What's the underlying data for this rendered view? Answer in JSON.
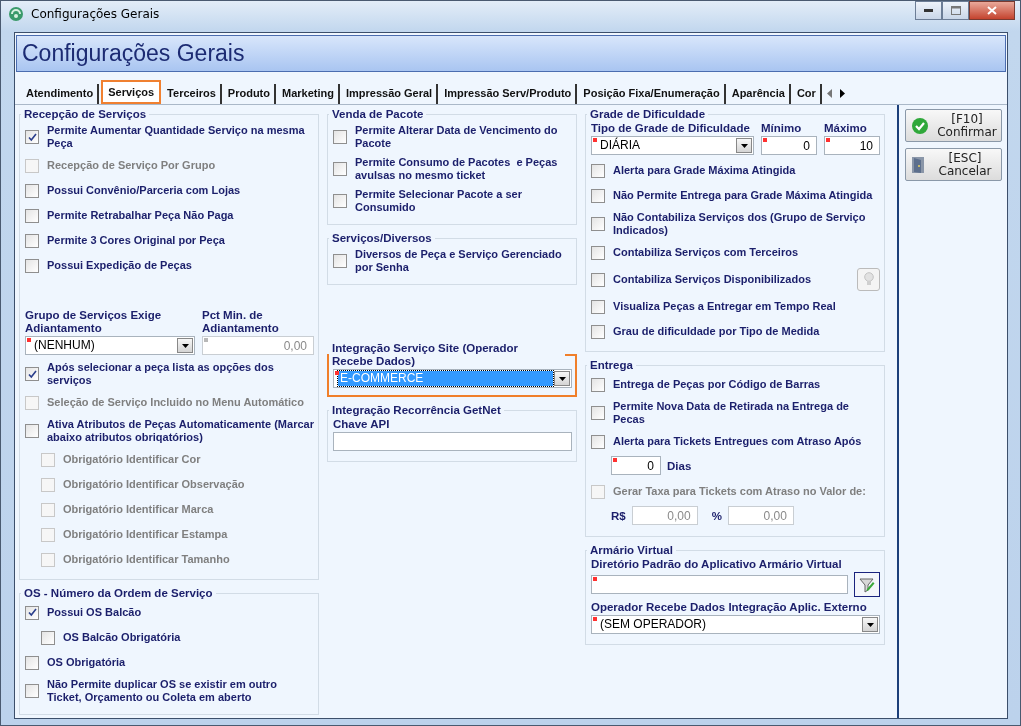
{
  "window": {
    "title": "Configurações Gerais"
  },
  "header": {
    "title": "Configurações Gerais"
  },
  "tabs": [
    {
      "label": "Atendimento",
      "selected": false
    },
    {
      "label": "Serviços",
      "selected": true
    },
    {
      "label": "Terceiros",
      "selected": false
    },
    {
      "label": "Produto",
      "selected": false
    },
    {
      "label": "Marketing",
      "selected": false
    },
    {
      "label": "Impressão Geral",
      "selected": false
    },
    {
      "label": "Impressão Serv/Produto",
      "selected": false
    },
    {
      "label": "Posição Fixa/Enumeração",
      "selected": false
    },
    {
      "label": "Aparência",
      "selected": false
    },
    {
      "label": "Cor",
      "selected": false
    }
  ],
  "columns": [
    {
      "sections": [
        {
          "title": "Recepção de Serviços",
          "highlighted": false,
          "items": [
            {
              "kind": "checkbox",
              "label": "Permite Aumentar Quantidade Serviço na mesma Peça",
              "checked": true,
              "disabled": false
            },
            {
              "kind": "checkbox",
              "label": "Recepção de Serviço Por Grupo",
              "checked": false,
              "disabled": true
            },
            {
              "kind": "checkbox",
              "label": "Possui Convênio/Parceria com Lojas",
              "checked": false,
              "disabled": false
            },
            {
              "kind": "checkbox",
              "label": "Permite Retrabalhar Peça Não Paga",
              "checked": false,
              "disabled": false
            },
            {
              "kind": "checkbox",
              "label": "Permite 3 Cores Original por Peça",
              "checked": false,
              "disabled": false
            },
            {
              "kind": "checkbox",
              "label": "Possui Expedição de Peças",
              "checked": false,
              "disabled": false
            },
            {
              "kind": "fields",
              "fields": [
                {
                  "kind": "combo",
                  "label": "Grupo de Serviços Exige Adiantamento",
                  "value": "(NENHUM)",
                  "required": true,
                  "disabled": false,
                  "focused": false
                },
                {
                  "kind": "number",
                  "label": "Pct Min. de Adiantamento",
                  "value": "0,00",
                  "required": true,
                  "disabled": true
                }
              ]
            },
            {
              "kind": "checkbox",
              "label": "Após selecionar a peça lista as opções dos serviços",
              "checked": true,
              "disabled": false
            },
            {
              "kind": "checkbox",
              "label": "Seleção de Serviço Incluido no Menu Automático",
              "checked": false,
              "disabled": true
            },
            {
              "kind": "checkbox",
              "label": "Ativa Atributos de Peças Automaticamente (Marcar abaixo atributos obriqatórios)",
              "checked": false,
              "disabled": false,
              "children": [
                {
                  "kind": "checkbox",
                  "label": "Obrigatório Identificar Cor",
                  "checked": false,
                  "disabled": true
                },
                {
                  "kind": "checkbox",
                  "label": "Obrigatório Identificar Observação",
                  "checked": false,
                  "disabled": true
                },
                {
                  "kind": "checkbox",
                  "label": "Obrigatório Identificar Marca",
                  "checked": false,
                  "disabled": true
                },
                {
                  "kind": "checkbox",
                  "label": "Obrigatório Identificar Estampa",
                  "checked": false,
                  "disabled": true
                },
                {
                  "kind": "checkbox",
                  "label": "Obrigatório Identificar Tamanho",
                  "checked": false,
                  "disabled": true
                }
              ]
            }
          ]
        },
        {
          "title": "OS - Número da Ordem de Serviço",
          "highlighted": false,
          "items": [
            {
              "kind": "checkbox",
              "label": "Possui OS Balcão",
              "checked": true,
              "disabled": false,
              "children": [
                {
                  "kind": "checkbox",
                  "label": "OS Balcão Obrigatória",
                  "checked": false,
                  "disabled": false
                }
              ]
            },
            {
              "kind": "checkbox",
              "label": "OS Obrigatória",
              "checked": false,
              "disabled": false
            },
            {
              "kind": "checkbox",
              "label": "Não Permite duplicar OS se existir em outro Ticket, Orçamento ou Coleta em aberto",
              "checked": false,
              "disabled": false
            }
          ]
        }
      ]
    },
    {
      "sections": [
        {
          "title": "Venda de Pacote",
          "highlighted": false,
          "items": [
            {
              "kind": "checkbox",
              "label": "Permite Alterar Data de Vencimento do Pacote",
              "checked": false,
              "disabled": false
            },
            {
              "kind": "checkbox",
              "label": "Permite Consumo de Pacotes  e Peças avulsas no mesmo ticket",
              "checked": false,
              "disabled": false
            },
            {
              "kind": "checkbox",
              "label": "Permite Selecionar Pacote a ser Consumido",
              "checked": false,
              "disabled": false
            }
          ]
        },
        {
          "title": "Serviços/Diversos",
          "highlighted": false,
          "items": [
            {
              "kind": "checkbox",
              "label": "Diversos de Peça e Serviço Gerenciado por Senha",
              "checked": false,
              "disabled": false
            }
          ]
        },
        {
          "title": "Integração Serviço Site (Operador Recebe Dados)",
          "highlighted": true,
          "items": [
            {
              "kind": "fields",
              "fields": [
                {
                  "kind": "combo",
                  "value": "E-COMMERCE",
                  "required": true,
                  "disabled": false,
                  "focused": true
                }
              ]
            }
          ]
        },
        {
          "title": "Integração Recorrência GetNet",
          "highlighted": false,
          "items": [
            {
              "kind": "fields",
              "fields": [
                {
                  "kind": "text",
                  "label": "Chave API",
                  "required": false,
                  "disabled": false
                }
              ]
            }
          ]
        }
      ]
    },
    {
      "sections": [
        {
          "title": "Grade de Dificuldade",
          "highlighted": false,
          "items": [
            {
              "kind": "fields",
              "fields": [
                {
                  "kind": "combo",
                  "label": "Tipo de Grade de Dificuldade",
                  "value": "DIÁRIA",
                  "required": true,
                  "disabled": false,
                  "focused": false
                },
                {
                  "kind": "number",
                  "label": "Mínimo",
                  "value": "0",
                  "required": true,
                  "disabled": false
                },
                {
                  "kind": "number",
                  "label": "Máximo",
                  "value": "10",
                  "required": true,
                  "disabled": false
                }
              ]
            },
            {
              "kind": "checkbox",
              "label": "Alerta para Grade Máxima Atingida",
              "checked": false,
              "disabled": false
            },
            {
              "kind": "checkbox",
              "label": "Não Permite Entrega para Grade Máxima Atingida",
              "checked": false,
              "disabled": false
            },
            {
              "kind": "checkbox",
              "label": "Não Contabiliza Serviços dos (Grupo de Serviço Indicados)",
              "checked": false,
              "disabled": false
            },
            {
              "kind": "checkbox",
              "label": "Contabiliza Serviços com Terceiros",
              "checked": false,
              "disabled": false
            },
            {
              "kind": "checkbox",
              "label": "Contabiliza Serviços Disponibilizados",
              "checked": false,
              "disabled": false,
              "tip_button": true
            },
            {
              "kind": "checkbox",
              "label": "Visualiza Peças a Entregar em Tempo Real",
              "checked": false,
              "disabled": false
            },
            {
              "kind": "checkbox",
              "label": "Grau de dificuldade por Tipo de Medida",
              "checked": false,
              "disabled": false
            }
          ]
        },
        {
          "title": "Entrega",
          "highlighted": false,
          "items": [
            {
              "kind": "checkbox",
              "label": "Entrega de Peças por Código de Barras",
              "checked": false,
              "disabled": false
            },
            {
              "kind": "checkbox",
              "label": "Permite Nova Data de Retirada na Entrega de Pecas",
              "checked": false,
              "disabled": false
            },
            {
              "kind": "checkbox",
              "label": "Alerta para Tickets Entregues com Atraso Após",
              "checked": false,
              "disabled": false,
              "fields": [
                {
                  "kind": "number",
                  "value": "0",
                  "suffix": "Dias",
                  "required": true,
                  "disabled": false
                }
              ]
            },
            {
              "kind": "checkbox",
              "label": "Gerar Taxa para Tickets com Atraso no Valor de:",
              "checked": false,
              "disabled": true,
              "fields": [
                {
                  "kind": "number",
                  "prefix": "R$",
                  "value": "0,00",
                  "required": false,
                  "disabled": true
                },
                {
                  "kind": "number",
                  "prefix": "%",
                  "value": "0,00",
                  "required": false,
                  "disabled": true
                }
              ]
            }
          ]
        },
        {
          "title": "Armário Virtual",
          "highlighted": false,
          "items": [
            {
              "kind": "fields",
              "fields": [
                {
                  "kind": "text",
                  "label": "Diretório Padrão do Aplicativo Armário Virtual",
                  "required": true,
                  "disabled": false,
                  "browse_button": true
                }
              ]
            },
            {
              "kind": "fields",
              "fields": [
                {
                  "kind": "combo",
                  "label": "Operador Recebe Dados Integração Aplic. Externo",
                  "value": "(SEM OPERADOR)",
                  "required": true,
                  "disabled": false,
                  "focused": false
                }
              ]
            }
          ]
        }
      ]
    }
  ],
  "buttons": [
    {
      "kind": "confirm",
      "key": "[F10]",
      "label": "Confirmar"
    },
    {
      "kind": "cancel",
      "key": "[ESC]",
      "label": "Cancelar"
    }
  ]
}
